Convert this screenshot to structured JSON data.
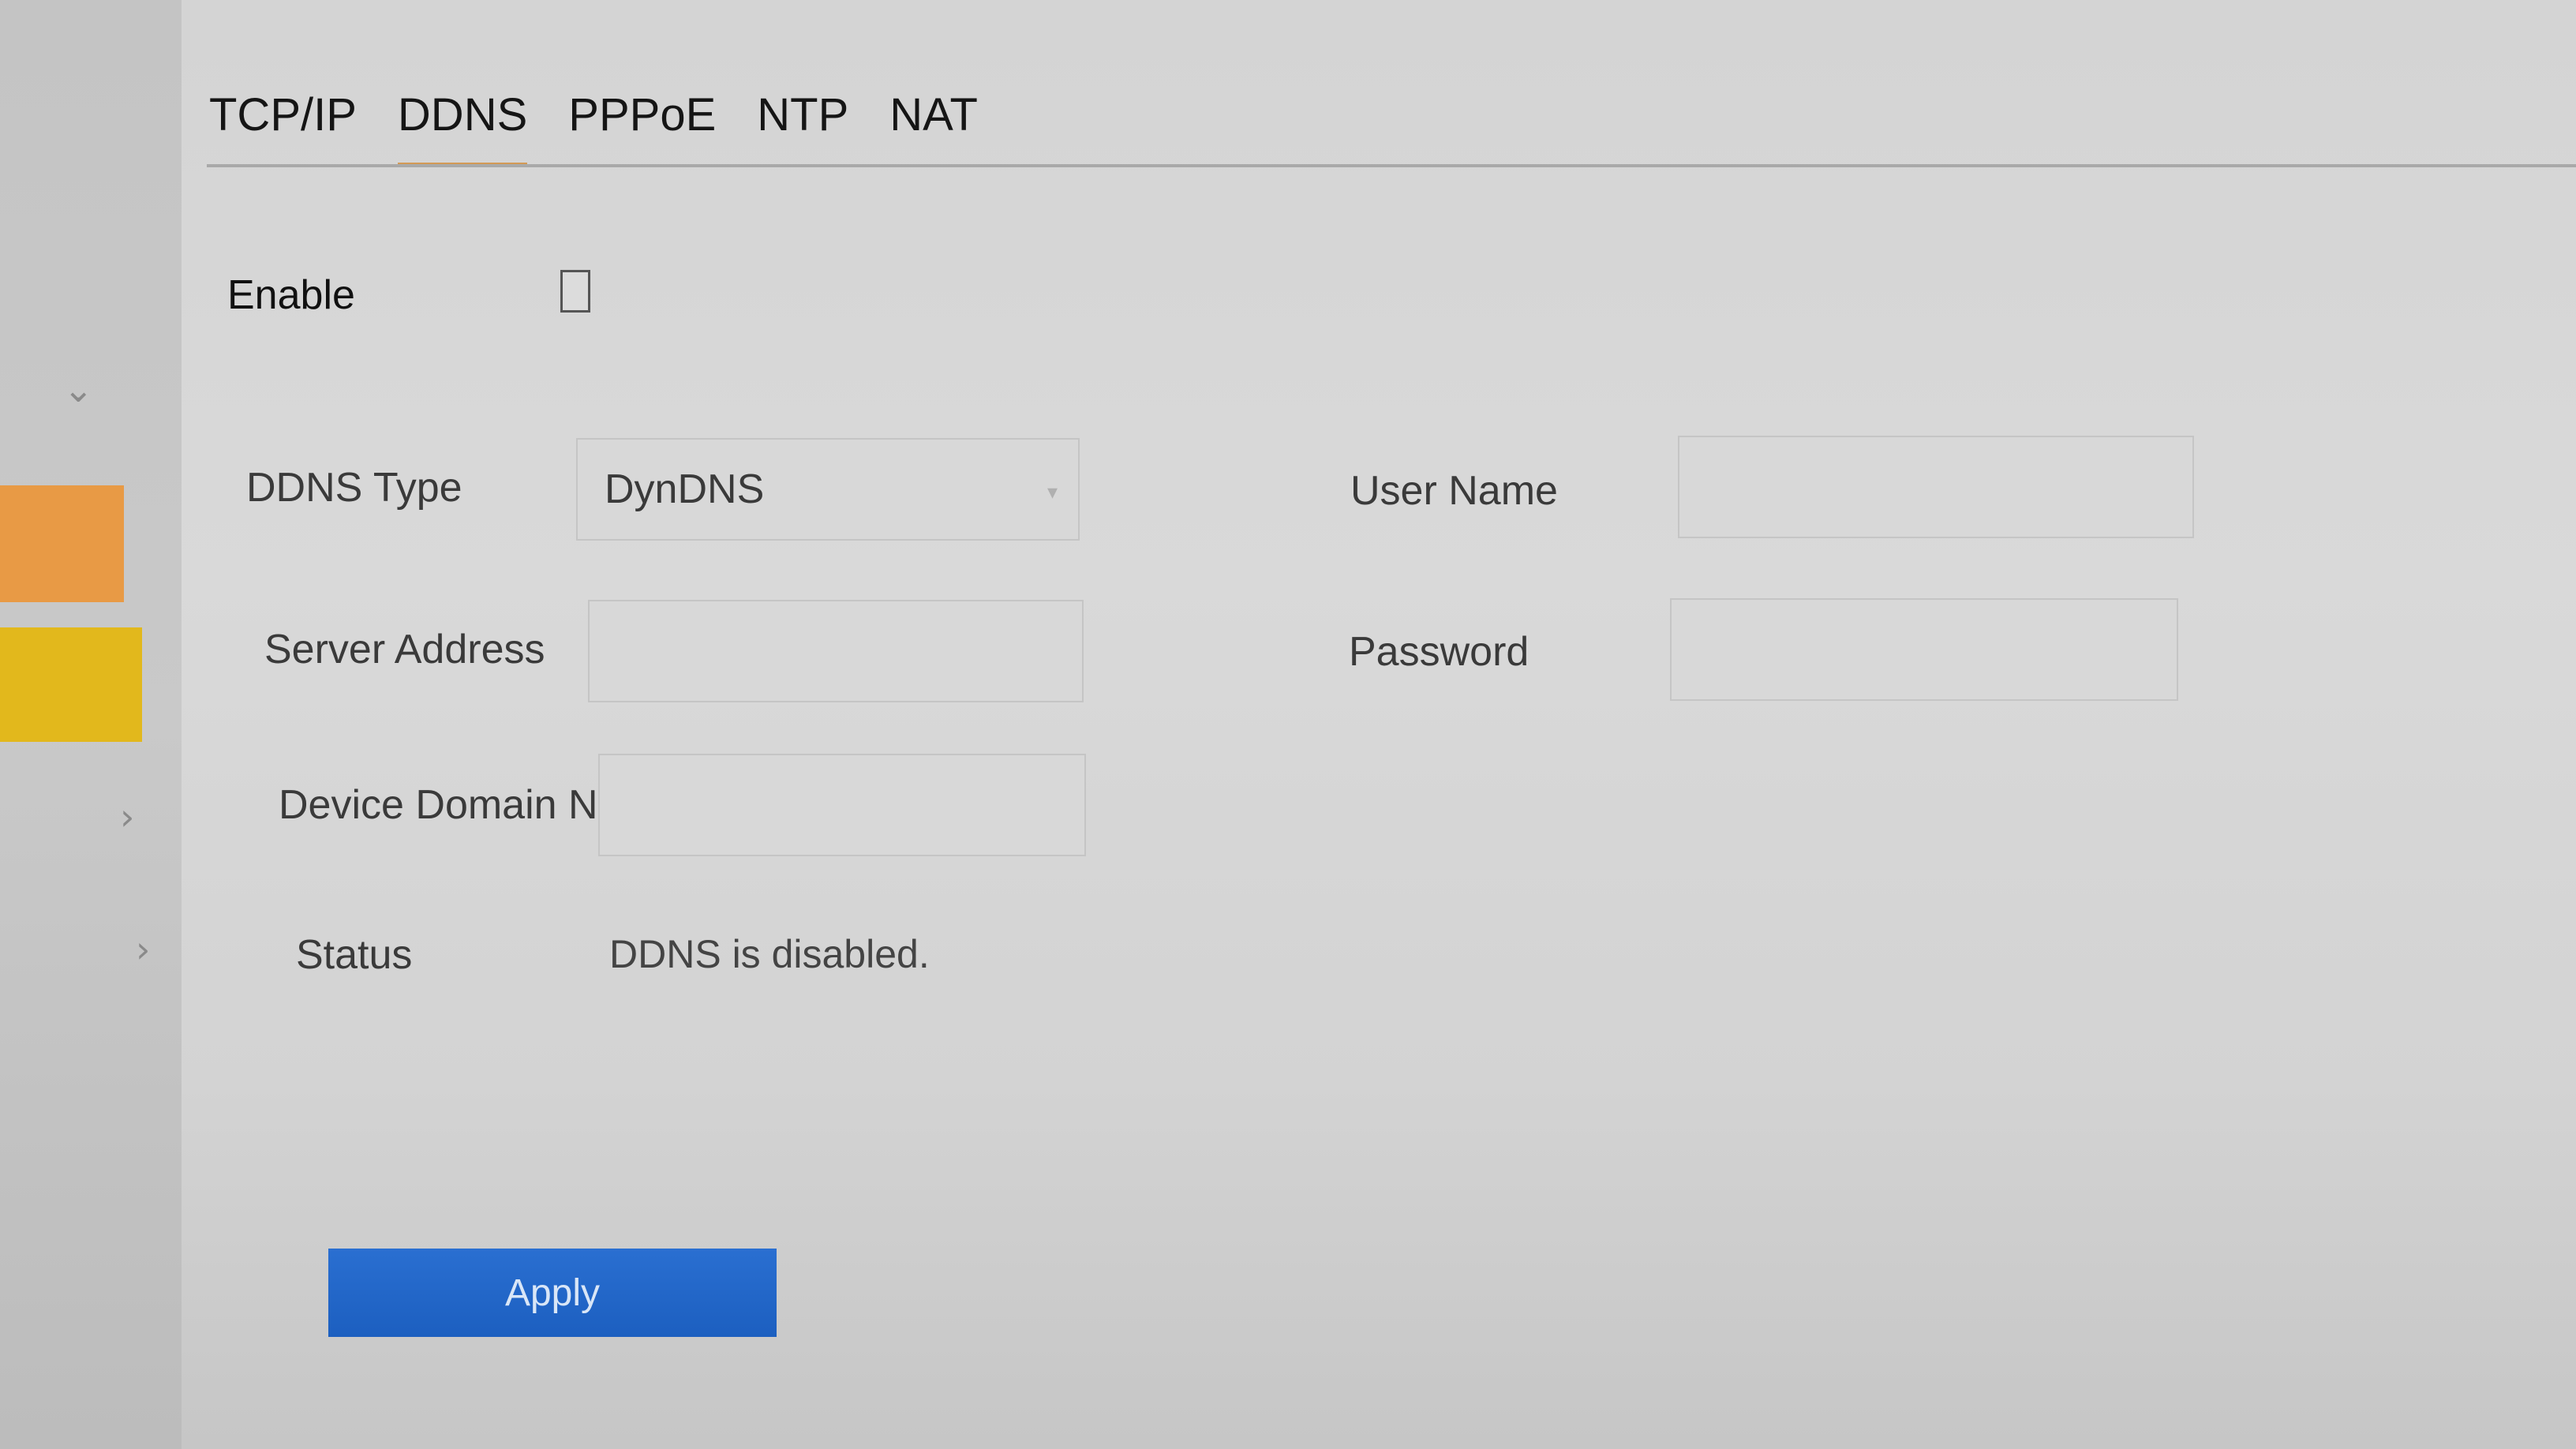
{
  "tabs": [
    {
      "label": "TCP/IP",
      "active": false
    },
    {
      "label": "DDNS",
      "active": true
    },
    {
      "label": "PPPoE",
      "active": false
    },
    {
      "label": "NTP",
      "active": false
    },
    {
      "label": "NAT",
      "active": false
    }
  ],
  "form": {
    "enable_label": "Enable",
    "enable_checked": false,
    "ddns_type_label": "DDNS Type",
    "ddns_type_value": "DynDNS",
    "server_address_label": "Server Address",
    "server_address_value": "",
    "device_domain_label": "Device Domain Name",
    "device_domain_value": "",
    "status_label": "Status",
    "status_value": "DDNS is disabled.",
    "user_name_label": "User Name",
    "user_name_value": "",
    "password_label": "Password",
    "password_value": ""
  },
  "apply_label": "Apply",
  "icons": {
    "sidebar_expand": "chevron-down-icon",
    "sidebar_item": "chevron-right-icon",
    "dropdown": "caret-down-icon"
  },
  "colors": {
    "tab_underline": "#d39a55",
    "apply_button": "#1f63c6",
    "sidebar_orange": "#e89a45",
    "sidebar_yellow": "#e2b81c"
  }
}
